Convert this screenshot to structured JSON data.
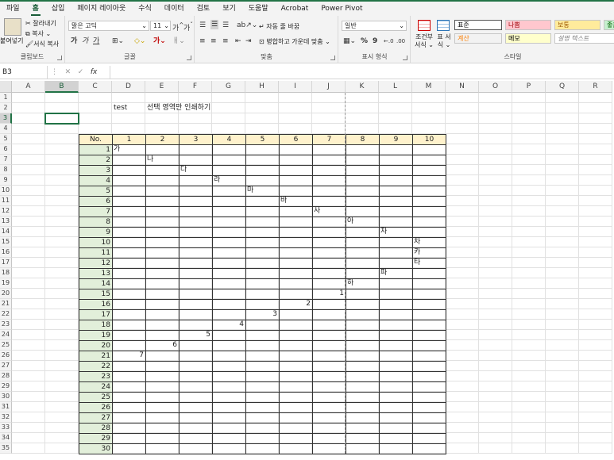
{
  "ribbon_tabs": [
    "파일",
    "홈",
    "삽입",
    "페이지 레이아웃",
    "수식",
    "데이터",
    "검토",
    "보기",
    "도움말",
    "Acrobat",
    "Power Pivot"
  ],
  "active_tab_index": 1,
  "clipboard": {
    "paste": "붙여넣기",
    "cut": "잘라내기",
    "copy": "복사",
    "format_painter": "서식 복사",
    "label": "클립보드"
  },
  "font": {
    "name": "맑은 고딕",
    "size": "11",
    "grow": "가",
    "shrink": "가",
    "bold": "가",
    "italic": "가",
    "underline": "가",
    "label": "글꼴"
  },
  "alignment": {
    "wrap_text": "자동 줄 바꿈",
    "merge_center": "병합하고 가운데 맞춤",
    "label": "맞춤"
  },
  "number": {
    "format": "일반",
    "percent": "%",
    "comma": "9",
    "label": "표시 형식"
  },
  "styles": {
    "conditional": "조건부 서식",
    "table_format": "표 서식",
    "label": "스타일",
    "boxes": [
      {
        "text": "표준",
        "bg": "#ffffff",
        "fg": "#000000"
      },
      {
        "text": "나쁨",
        "bg": "#ffc7ce",
        "fg": "#9c0006"
      },
      {
        "text": "보통",
        "bg": "#ffeb9c",
        "fg": "#9c5700"
      },
      {
        "text": "좋음",
        "bg": "#c6efce",
        "fg": "#006100"
      },
      {
        "text": "계산",
        "bg": "#f2f2f2",
        "fg": "#fa7d00"
      },
      {
        "text": "메모",
        "bg": "#ffffcc",
        "fg": "#000000"
      },
      {
        "text": "설명 텍스트",
        "bg": "#ffffff",
        "fg": "#7f7f7f"
      }
    ]
  },
  "formula_bar": {
    "name_box": "B3",
    "cancel": "✕",
    "enter": "✓",
    "fx": "fx",
    "value": ""
  },
  "columns": [
    "A",
    "B",
    "C",
    "D",
    "E",
    "F",
    "G",
    "H",
    "I",
    "J",
    "K",
    "L",
    "M",
    "N",
    "O",
    "P",
    "Q",
    "R"
  ],
  "selected_column": "B",
  "selected_row": 3,
  "row_count": 35,
  "sheet": {
    "D2": "test",
    "E2": "선택 영역만 인쇄하기",
    "table_header_label": "No.",
    "table_header_numbers": [
      "1",
      "2",
      "3",
      "4",
      "5",
      "6",
      "7",
      "8",
      "9",
      "10"
    ],
    "row_numbers": [
      "1",
      "2",
      "3",
      "4",
      "5",
      "6",
      "7",
      "8",
      "9",
      "10",
      "11",
      "12",
      "13",
      "14",
      "15",
      "16",
      "17",
      "18",
      "19",
      "20",
      "21",
      "22",
      "23",
      "24",
      "25",
      "26",
      "27",
      "28",
      "29",
      "30"
    ],
    "entries": [
      {
        "row": 6,
        "col": "D",
        "text": "가",
        "align": "left"
      },
      {
        "row": 7,
        "col": "E",
        "text": "나",
        "align": "left"
      },
      {
        "row": 8,
        "col": "F",
        "text": "다",
        "align": "left"
      },
      {
        "row": 9,
        "col": "G",
        "text": "라",
        "align": "left"
      },
      {
        "row": 10,
        "col": "H",
        "text": "마",
        "align": "left"
      },
      {
        "row": 11,
        "col": "I",
        "text": "바",
        "align": "left"
      },
      {
        "row": 12,
        "col": "J",
        "text": "사",
        "align": "left"
      },
      {
        "row": 13,
        "col": "K",
        "text": "아",
        "align": "left"
      },
      {
        "row": 14,
        "col": "L",
        "text": "자",
        "align": "left"
      },
      {
        "row": 15,
        "col": "M",
        "text": "차",
        "align": "left"
      },
      {
        "row": 16,
        "col": "M",
        "text": "카",
        "align": "left"
      },
      {
        "row": 17,
        "col": "M",
        "text": "타",
        "align": "left"
      },
      {
        "row": 18,
        "col": "L",
        "text": "파",
        "align": "left"
      },
      {
        "row": 19,
        "col": "K",
        "text": "하",
        "align": "left"
      },
      {
        "row": 20,
        "col": "J",
        "text": "1",
        "align": "right"
      },
      {
        "row": 21,
        "col": "I",
        "text": "2",
        "align": "right"
      },
      {
        "row": 22,
        "col": "H",
        "text": "3",
        "align": "right"
      },
      {
        "row": 23,
        "col": "G",
        "text": "4",
        "align": "right"
      },
      {
        "row": 24,
        "col": "F",
        "text": "5",
        "align": "right"
      },
      {
        "row": 25,
        "col": "E",
        "text": "6",
        "align": "right"
      },
      {
        "row": 26,
        "col": "D",
        "text": "7",
        "align": "right"
      }
    ]
  },
  "colors": {
    "accent": "#217346",
    "header_fill": "#fff2cc",
    "number_fill": "#e2efda"
  }
}
